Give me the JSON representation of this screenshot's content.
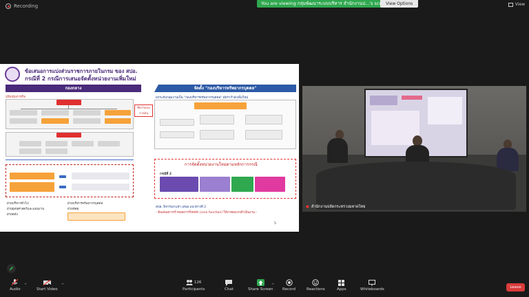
{
  "topbar": {
    "recording_label": "Recording",
    "viewing_text": "You are viewing กลุ่มพัฒนาระบบบริหาร สำนักงานป...'s screen",
    "view_options_label": "View Options",
    "view_label": "View"
  },
  "slide": {
    "title_line1": "ข้อเสนอการแบ่งส่วนราชการภายในกรม ของ สปอ.",
    "title_line2": "กรณีที่ 2  กรณีการเสนอจัดตั้งหน่วยงานเพิ่มใหม่",
    "left_band": "กองกลาง",
    "right_band": "จัดตั้ง \"กองบริหารทรัพยากรบุคคล\"",
    "right_subtitle": "ยกระดับกลุ่มงานเป็น \"กองบริหารทรัพยากรบุคคล\" อัตรากำลังเพิ่มใหม่",
    "left_subtitle": "ปรับปรุงภารกิจ",
    "tag_text": "ที่จะไปกองการเงิน",
    "bottom_caption": "การจัดตั้งหน่วยงานใหม่ตามหลักการกรณี",
    "case_label": "กรณีที่ 2",
    "note_line1": "สปอ. พิจารณาแล้ว เสนอ แนวทางที่ 2",
    "note_line2": "- ข้อเสนอการกำหนดภารกิจหลัก (core function) ให้ภาคผนวกดำเนินงาน -",
    "page_number": "5",
    "list_items": [
      "ฝ่ายบริหารทั่วไป",
      "ฝ่ายยุทธศาสตร์และแผนงาน",
      "ฝ่ายคลัง",
      "ฝ่ายบริหารทรัพยากรบุคคล",
      "ฝ่ายพัสดุ"
    ]
  },
  "video": {
    "participant_label": "สำนักงานปลัดกระทรวงมหาดไทย"
  },
  "toolbar": {
    "audio": "Audio",
    "start_video": "Start Video",
    "participants": "Participants",
    "participant_count": "126",
    "chat": "Chat",
    "share_screen": "Share Screen",
    "record": "Record",
    "reactions": "Reactions",
    "apps": "Apps",
    "whiteboards": "Whiteboards",
    "leave": "Leave"
  },
  "colors": {
    "accent_green": "#2fa84f",
    "leave_red": "#d93b3b",
    "slide_purple": "#4a2a7a",
    "slide_blue": "#2d5aa6",
    "slide_red": "#e03030",
    "slide_orange": "#f6a23a"
  }
}
